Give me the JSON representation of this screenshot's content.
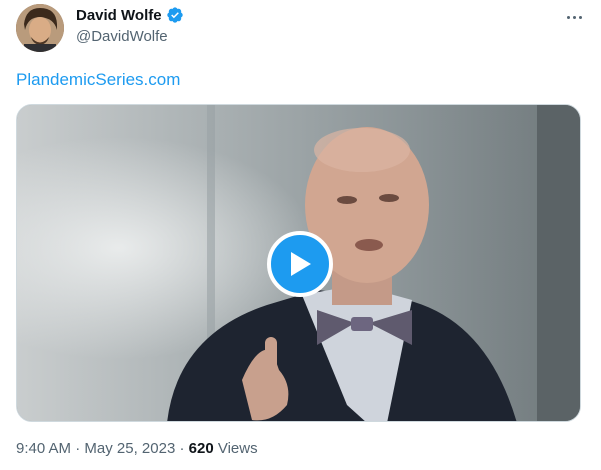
{
  "author": {
    "display_name": "David Wolfe",
    "handle": "@DavidWolfe",
    "verified": true,
    "avatar_icon": "profile-photo"
  },
  "tweet": {
    "link_text": "PlandemicSeries.com",
    "media_type": "video",
    "media_icon": "play-icon",
    "time": "9:40 AM",
    "separator": "·",
    "date": "May 25, 2023",
    "views_count": "620",
    "views_label": "Views"
  },
  "colors": {
    "link": "#1d9bf0",
    "verified_badge": "#1d9bf0",
    "play_button": "#1d9bf0",
    "secondary_text": "#536471"
  }
}
